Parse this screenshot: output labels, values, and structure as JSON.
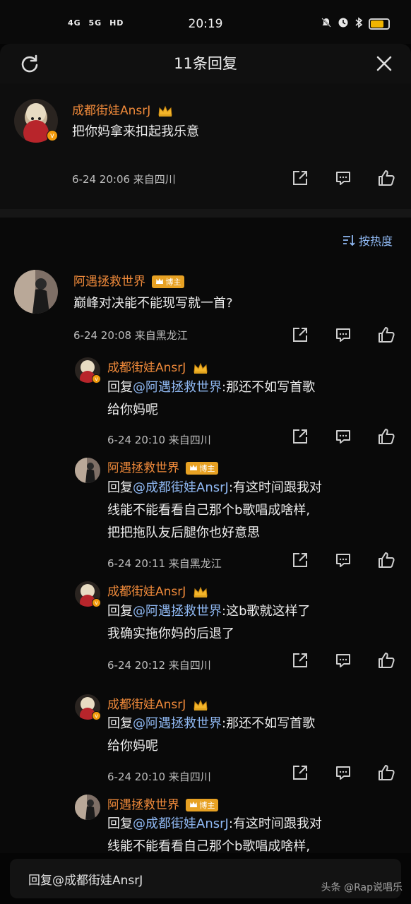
{
  "status": {
    "net1": "4G",
    "net2": "5G",
    "net3": "HD",
    "time": "20:19"
  },
  "header": {
    "title": "11条回复"
  },
  "original": {
    "user": "成都街娃AnsrJ",
    "text": "把你妈拿来扣起我乐意",
    "meta": "6-24 20:06 来自四川"
  },
  "sort_label": "按热度",
  "comments": [
    {
      "user": "阿遇拯救世界",
      "badge": "博主",
      "line1": "巅峰对决能不能现写就一首?",
      "meta": "6-24 20:08 来自黑龙江"
    },
    {
      "user": "成都街娃AnsrJ",
      "prefix": "回复",
      "mention": "@阿遇拯救世界",
      "line1_rest": ":那还不如写首歌",
      "line2": "给你妈呢",
      "meta": "6-24 20:10 来自四川"
    },
    {
      "user": "阿遇拯救世界",
      "badge": "博主",
      "prefix": "回复",
      "mention": "@成都街娃AnsrJ",
      "line1_rest": ":有这时间跟我对",
      "line2": "线能不能看看自己那个b歌唱成啥样,",
      "line3": "把把拖队友后腿你也好意思",
      "meta": "6-24 20:11 来自黑龙江"
    },
    {
      "user": "成都街娃AnsrJ",
      "prefix": "回复",
      "mention": "@阿遇拯救世界",
      "line1_rest": ":这b歌就这样了",
      "line2": "我确实拖你妈的后退了",
      "meta": "6-24 20:12 来自四川"
    },
    {
      "user": "成都街娃AnsrJ",
      "prefix": "回复",
      "mention": "@阿遇拯救世界",
      "line1_rest": ":那还不如写首歌",
      "line2": "给你妈呢",
      "meta": "6-24 20:10 来自四川"
    },
    {
      "user": "阿遇拯救世界",
      "badge": "博主",
      "prefix": "回复",
      "mention": "@成都街娃AnsrJ",
      "line1_rest": ":有这时间跟我对",
      "line2": "线能不能看看自己那个b歌唱成啥样,"
    }
  ],
  "reply_bar": {
    "placeholder": "回复@成都街娃AnsrJ"
  },
  "watermark": "头条 @Rap说唱乐",
  "colors": {
    "username": "#f08a3a",
    "mention": "#8fb8f2",
    "background": "#050505",
    "badge": "#e7a123"
  },
  "icons": [
    "refresh-icon",
    "close-icon",
    "share-icon",
    "comment-icon",
    "like-icon",
    "crown-icon",
    "verified-icon",
    "sort-icon"
  ]
}
